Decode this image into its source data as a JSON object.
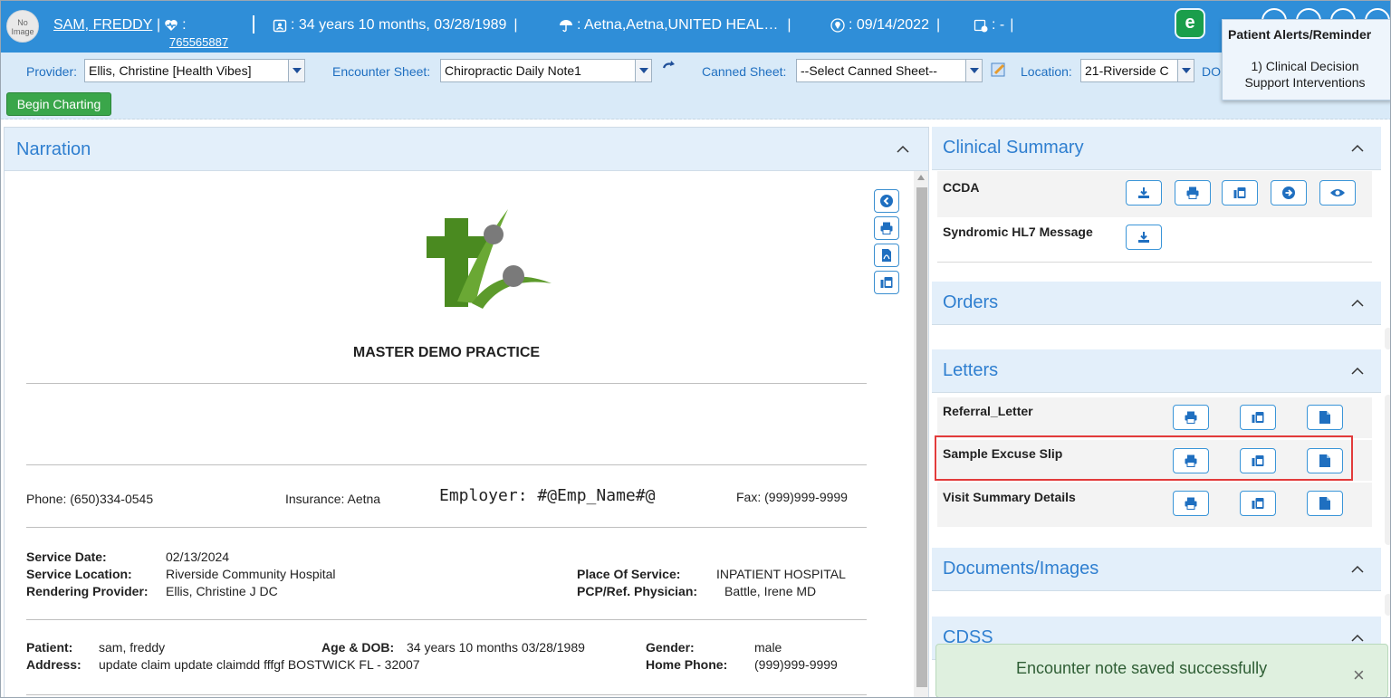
{
  "header": {
    "no_image": "No Image",
    "patient_name": "SAM, FREDDY",
    "patient_id": "765565887",
    "colon": ":",
    "age_dob": ": 34 years 10 months, 03/28/1989",
    "insurance": ": Aetna,Aetna,UNITED HEAL…",
    "visit_date": ": 09/14/2022",
    "extra": ": -",
    "logo_letter": "e"
  },
  "alert": {
    "title": "Patient Alerts/Reminder",
    "body": "1) Clinical Decision Support Interventions"
  },
  "toolbar": {
    "provider_label": "Provider:",
    "provider_value": "Ellis, Christine [Health Vibes]",
    "encounter_label": "Encounter Sheet:",
    "encounter_value": "Chiropractic Daily Note1",
    "canned_label": "Canned Sheet:",
    "canned_value": "--Select Canned Sheet--",
    "location_label": "Location:",
    "location_value": "21-Riverside C",
    "dos_label": "DO",
    "begin_charting": "Begin Charting"
  },
  "narration": {
    "title": "Narration",
    "practice_name": "MASTER DEMO PRACTICE",
    "phone": "Phone: (650)334-0545",
    "insurance": "Insurance: Aetna",
    "employer": "Employer:  #@Emp_Name#@",
    "fax": "Fax: (999)999-9999",
    "service_date_label": "Service Date:",
    "service_date": "02/13/2024",
    "service_location_label": "Service Location:",
    "service_location": "Riverside Community Hospital",
    "rendering_label": "Rendering Provider:",
    "rendering": "Ellis, Christine J  DC",
    "pos_label": "Place Of Service:",
    "pos": "INPATIENT HOSPITAL",
    "pcp_label": "PCP/Ref. Physician:",
    "pcp": "Battle, Irene MD",
    "patient_label": "Patient:",
    "patient": "sam, freddy",
    "address_label": "Address:",
    "address": "update claim update claimdd fffgf  BOSTWICK  FL - 32007",
    "age_label": "Age & DOB:",
    "age": "34 years 10 months  03/28/1989",
    "gender_label": "Gender:",
    "gender": "male",
    "home_phone_label": "Home Phone:",
    "home_phone": "(999)999-9999"
  },
  "clinical_summary": {
    "title": "Clinical Summary",
    "rows": [
      "CCDA",
      "Syndromic HL7 Message"
    ]
  },
  "orders": {
    "title": "Orders"
  },
  "letters": {
    "title": "Letters",
    "rows": [
      "Referral_Letter",
      "Sample Excuse Slip",
      "Visit Summary Details"
    ]
  },
  "documents": {
    "title": "Documents/Images"
  },
  "cdss": {
    "title": "CDSS"
  },
  "toast": {
    "message": "Encounter note saved successfully",
    "close": "×"
  }
}
